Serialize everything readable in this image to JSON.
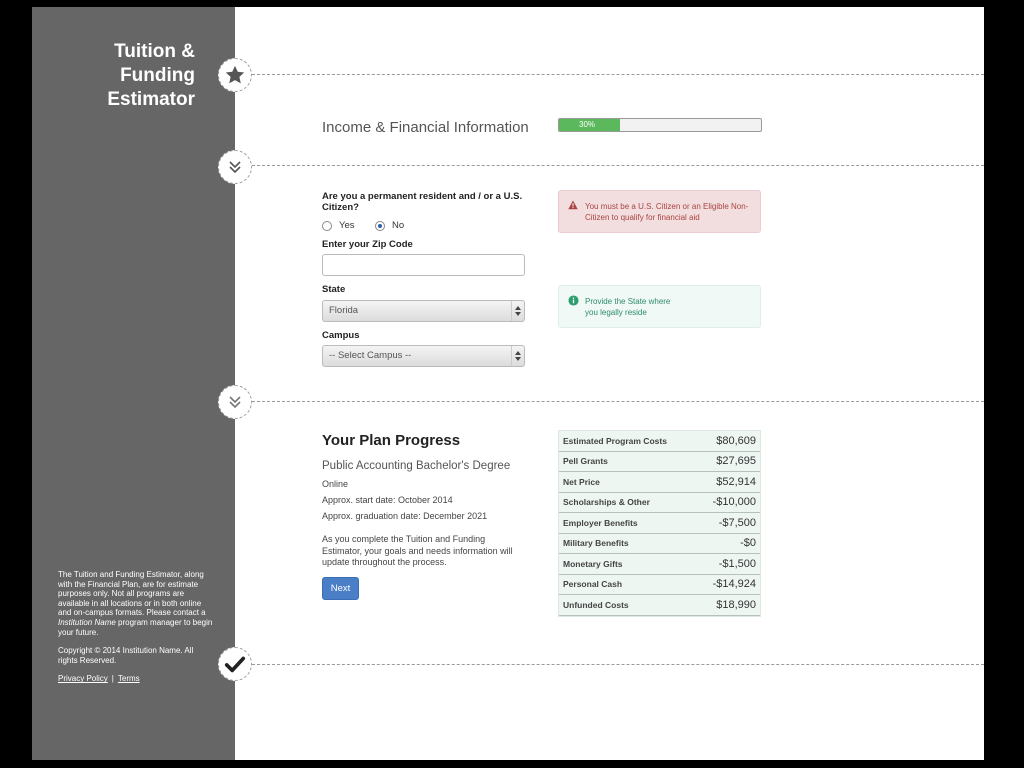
{
  "brand": {
    "line1": "Tuition &",
    "line2": "Funding",
    "line3": "Estimator"
  },
  "progress": {
    "label": "Income & Financial Information",
    "percent_text": "30%",
    "percent": 30
  },
  "form": {
    "citizen_question": "Are you a permanent resident and / or a U.S. Citizen?",
    "yes_label": "Yes",
    "no_label": "No",
    "selected": "No",
    "zip_label": "Enter your Zip Code",
    "zip_value": "",
    "state_label": "State",
    "state_value": "Florida",
    "campus_label": "Campus",
    "campus_value": "-- Select Campus --"
  },
  "alerts": {
    "danger": "You must be a U.S. Citizen or an Eligible Non-Citizen to qualify for financial aid",
    "info": "Provide the State where you legally reside"
  },
  "plan": {
    "title": "Your Plan Progress",
    "program": "Public Accounting Bachelor's Degree",
    "format": "Online",
    "start": "Approx. start date: October 2014",
    "graduation": "Approx. graduation date: December 2021",
    "description": "As you complete the Tuition and Funding Estimator, your goals and needs information will update throughout the process.",
    "next_label": "Next"
  },
  "costs": [
    {
      "label": "Estimated Program Costs",
      "value": "$80,609"
    },
    {
      "label": "Pell Grants",
      "value": "$27,695"
    },
    {
      "label": "Net Price",
      "value": "$52,914"
    },
    {
      "label": "Scholarships & Other",
      "value": "-$10,000"
    },
    {
      "label": "Employer Benefits",
      "value": "-$7,500"
    },
    {
      "label": "Military Benefits",
      "value": "-$0"
    },
    {
      "label": "Monetary Gifts",
      "value": "-$1,500"
    },
    {
      "label": "Personal Cash",
      "value": "-$14,924"
    },
    {
      "label": "Unfunded Costs",
      "value": "$18,990"
    }
  ],
  "disclaimer": {
    "text_before": "The Tuition and Funding Estimator, along with the Financial Plan, are for estimate purposes only. Not all programs are available in all locations or in both online and on-campus formats. Please contact a ",
    "institution": "Institution Name",
    "text_after": " program manager to begin your future.",
    "copyright": "Copyright © 2014 Institution Name. All rights Reserved.",
    "privacy": "Privacy Policy",
    "separator": "|",
    "terms": "Terms"
  },
  "icons": [
    "star-icon",
    "double-chevron-down-icon",
    "checkmark-icon",
    "warning-icon",
    "info-icon"
  ],
  "colors": {
    "sidebar": "#666666",
    "progress": "#5cb85c",
    "button": "#4a7fc7",
    "danger_bg": "#f2dede",
    "info_bg": "#f0f9f6"
  }
}
